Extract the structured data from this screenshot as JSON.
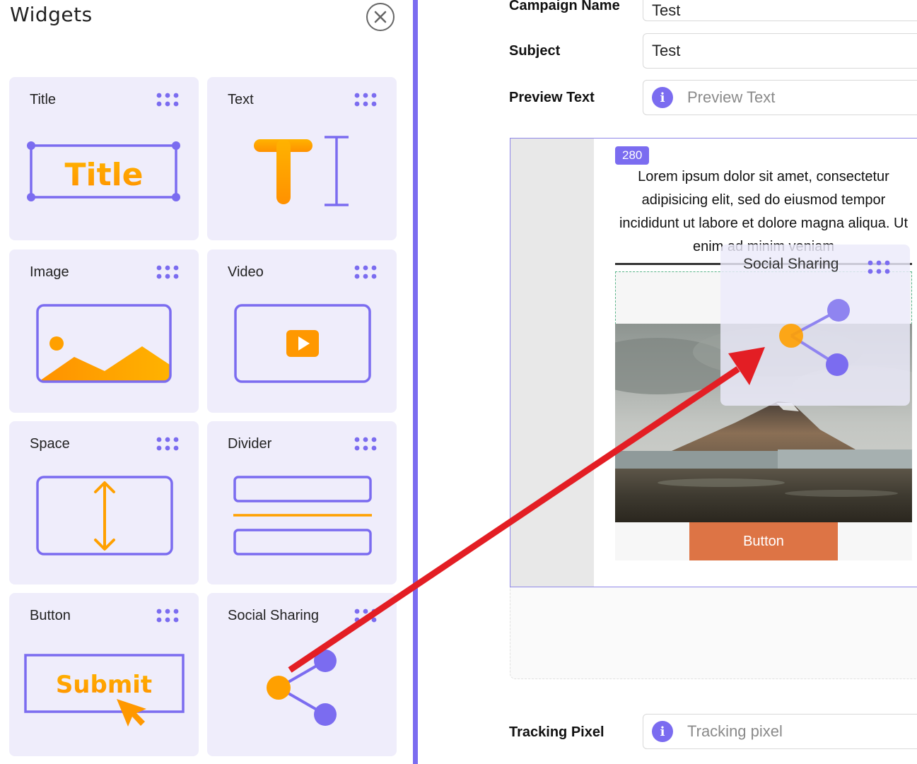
{
  "sidebar": {
    "title": "Widgets",
    "widgets": [
      {
        "label": "Title",
        "graphic_text": "Title"
      },
      {
        "label": "Text",
        "graphic_text": "T"
      },
      {
        "label": "Image"
      },
      {
        "label": "Video"
      },
      {
        "label": "Space"
      },
      {
        "label": "Divider"
      },
      {
        "label": "Button",
        "graphic_text": "Submit"
      },
      {
        "label": "Social Sharing"
      }
    ]
  },
  "form": {
    "campaign_name_label": "Campaign Name",
    "campaign_name_value": "Test",
    "subject_label": "Subject",
    "subject_value": "Test",
    "preview_text_label": "Preview Text",
    "preview_text_placeholder": "Preview Text",
    "tracking_pixel_label": "Tracking Pixel",
    "tracking_pixel_placeholder": "Tracking pixel",
    "info_icon": "i"
  },
  "email": {
    "block_badge": "280",
    "lorem_text": "Lorem ipsum dolor sit amet, consectetur adipisicing elit, sed do eiusmod tempor incididunt ut labore et dolore magna aliqua. Ut enim ad minim veniam",
    "button_label": "Button"
  },
  "drag": {
    "ghost_label": "Social Sharing"
  },
  "colors": {
    "accent_purple": "#7b6cf0",
    "accent_orange": "#ffa000",
    "email_button": "#dd7445",
    "arrow_red": "#e31e24"
  },
  "icons": {
    "close": "close-icon",
    "dots": "drag-dots-icon",
    "info": "info-icon",
    "share": "share-icon",
    "arrow": "annotation-arrow"
  }
}
